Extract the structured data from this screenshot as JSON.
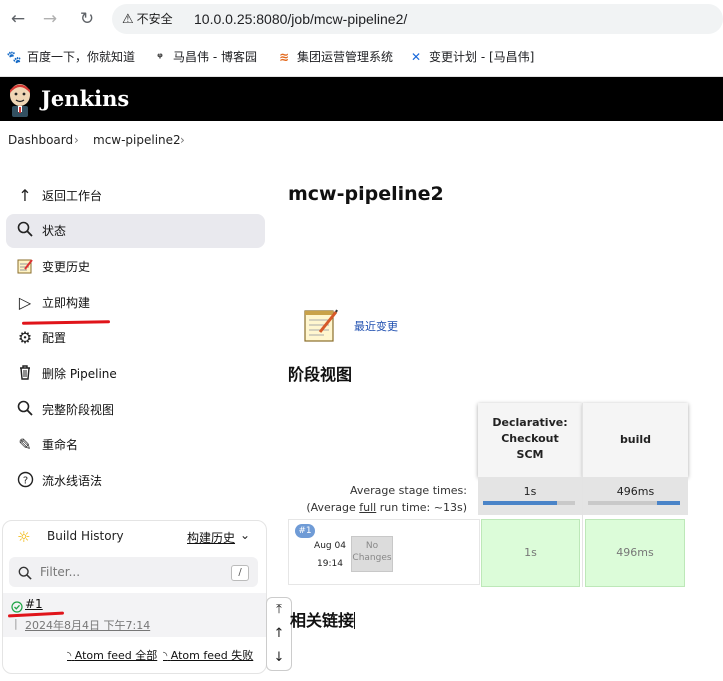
{
  "browser": {
    "security_label": "不安全",
    "url": "10.0.0.25:8080/job/mcw-pipeline2/"
  },
  "bookmarks": [
    {
      "label": "百度一下，你就知道",
      "icon": "baidu-paw-icon"
    },
    {
      "label": "马昌伟 - 博客园",
      "icon": "cnblogs-icon"
    },
    {
      "label": "集团运营管理系统",
      "icon": "flame-icon"
    },
    {
      "label": "变更计划 - [马昌伟]",
      "icon": "confluence-icon"
    }
  ],
  "header": {
    "title": "Jenkins"
  },
  "breadcrumb": {
    "items": [
      "Dashboard",
      "mcw-pipeline2"
    ]
  },
  "sidebar": {
    "items": [
      {
        "label": "返回工作台",
        "icon": "arrow-up-icon"
      },
      {
        "label": "状态",
        "icon": "search-icon"
      },
      {
        "label": "变更历史",
        "icon": "notepad-icon"
      },
      {
        "label": "立即构建",
        "icon": "play-icon"
      },
      {
        "label": "配置",
        "icon": "gear-icon"
      },
      {
        "label": "删除 Pipeline",
        "icon": "trash-icon"
      },
      {
        "label": "完整阶段视图",
        "icon": "search-icon"
      },
      {
        "label": "重命名",
        "icon": "pencil-icon"
      },
      {
        "label": "流水线语法",
        "icon": "help-icon"
      }
    ]
  },
  "build_history": {
    "title": "Build History",
    "trend_link": "构建历史",
    "filter_placeholder": "Filter...",
    "filter_shortcut": "/",
    "builds": [
      {
        "number": "#1",
        "date": "2024年8月4日 下午7:14"
      }
    ],
    "feeds": [
      "Atom feed 全部",
      "Atom feed 失败"
    ]
  },
  "main": {
    "title": "mcw-pipeline2",
    "changes_link": "最近变更",
    "stage_view_heading": "阶段视图",
    "related_links_heading": "相关链接"
  },
  "stage_view": {
    "avg_stage_label": "Average stage times:",
    "avg_run_prefix": "(Average ",
    "avg_run_link": "full",
    "avg_run_suffix": " run time: ~13s)",
    "stages": [
      {
        "name_lines": [
          "Declarative:",
          "Checkout",
          "SCM"
        ],
        "avg": "1s",
        "avg_fraction": 0.8,
        "result": "1s"
      },
      {
        "name_lines": [
          "build"
        ],
        "avg": "496ms",
        "avg_fraction": 0.25,
        "result": "496ms"
      }
    ],
    "run": {
      "badge": "#1",
      "date": "Aug 04",
      "time": "19:14",
      "no_changes": [
        "No",
        "Changes"
      ]
    },
    "colors": {
      "success": "#dcfcd9",
      "bar": "#4a84c8"
    }
  }
}
